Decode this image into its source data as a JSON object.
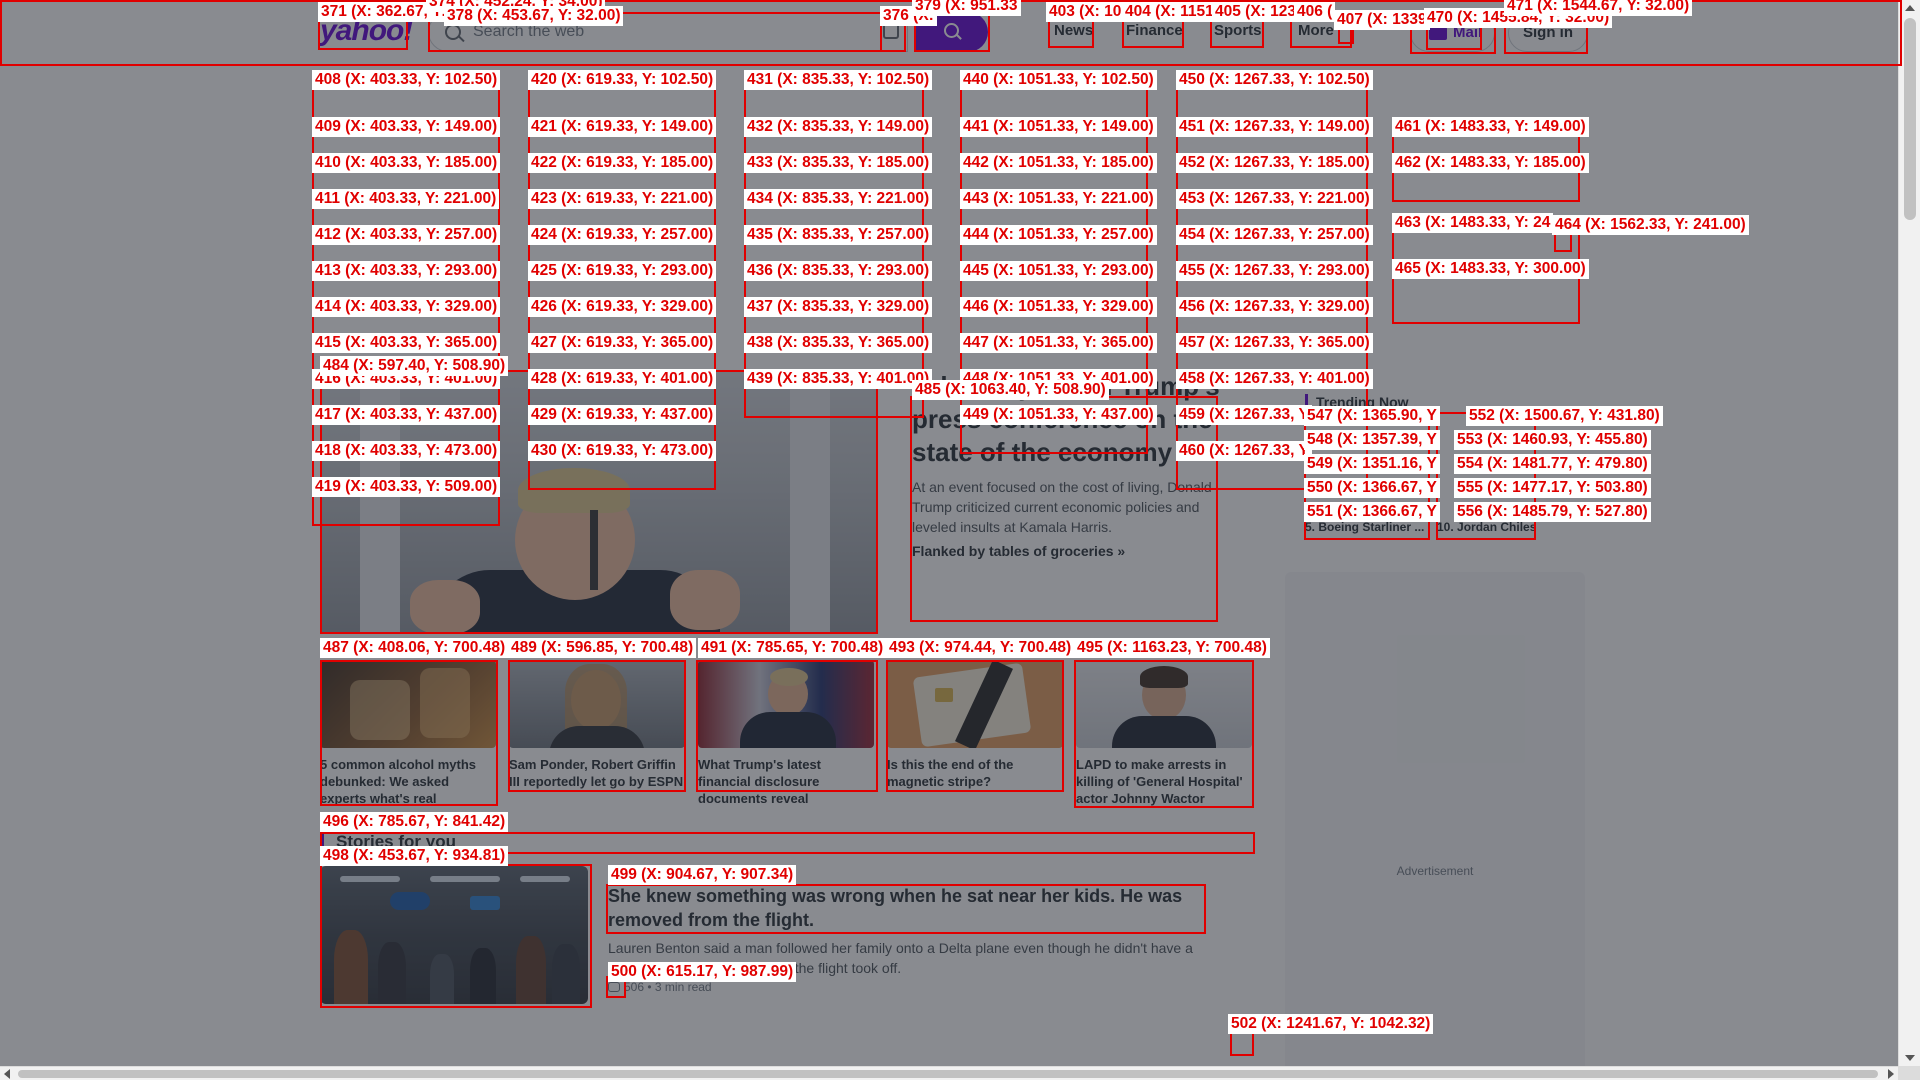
{
  "header": {
    "logo": "yahoo!",
    "search_placeholder": "Search the web",
    "nav": [
      "News",
      "Finance",
      "Sports",
      "More"
    ],
    "mail_label": "Mail",
    "signin_label": "Sign in"
  },
  "hero": {
    "title": "Takeaways from Trump's press conference on the state of the economy",
    "description": "At an event focused on the cost of living, Donald Trump criticized current economic policies and leveled insults at Kamala Harris.",
    "link": "Flanked by tables of groceries »"
  },
  "cards": [
    {
      "title": "5 common alcohol myths debunked: We asked experts what's real",
      "image": "whiskey-glass"
    },
    {
      "title": "Sam Ponder, Robert Griffin III reportedly let go by ESPN",
      "image": "woman-portrait"
    },
    {
      "title": "What Trump's latest financial disclosure documents reveal",
      "image": "trump-flags"
    },
    {
      "title": "Is this the end of the magnetic stripe?",
      "image": "credit-card"
    },
    {
      "title": "LAPD to make arrests in killing of 'General Hospital' actor Johnny Wactor",
      "image": "man-portrait"
    }
  ],
  "stories": {
    "heading": "Stories for you",
    "items": [
      {
        "title": "She knew something was wrong when he sat near her kids. He was removed from the flight.",
        "description": "Lauren Benton said a man followed her family onto a Delta plane even though he didn't have a seat. He was removed before the flight took off.",
        "comments": "506",
        "read_time": "3 min read"
      }
    ]
  },
  "trending": {
    "heading": "Trending Now",
    "left_item": "5. Boeing Starliner ...",
    "right_item": "10. Jordan Chiles"
  },
  "ad_label": "Advertisement",
  "annotations": [
    {
      "text": "371 (X: 362.67, Y: 32.00)"
    },
    {
      "text": "374 (X: 452.24, Y: 34.00)"
    },
    {
      "text": "378 (X: 453.67, Y: 32.00)"
    },
    {
      "text": "376 (X:"
    },
    {
      "text": "379 (X: 951.33"
    },
    {
      "text": "403 (X: 10"
    },
    {
      "text": "404 (X: 1151"
    },
    {
      "text": "405 (X: 123"
    },
    {
      "text": "406 ("
    },
    {
      "text": "407 (X: 1339"
    },
    {
      "text": "470 (X: 1455.84, Y: 32.00)"
    },
    {
      "text": "471 (X: 1544.67, Y: 32.00)"
    },
    {
      "text": "408 (X: 403.33, Y: 102.50)"
    },
    {
      "text": "409 (X: 403.33, Y: 149.00)"
    },
    {
      "text": "410 (X: 403.33, Y: 185.00)"
    },
    {
      "text": "411 (X: 403.33, Y: 221.00)"
    },
    {
      "text": "412 (X: 403.33, Y: 257.00)"
    },
    {
      "text": "413 (X: 403.33, Y: 293.00)"
    },
    {
      "text": "414 (X: 403.33, Y: 329.00)"
    },
    {
      "text": "415 (X: 403.33, Y: 365.00)"
    },
    {
      "text": "416 (X: 403.33, Y: 401.00)"
    },
    {
      "text": "417 (X: 403.33, Y: 437.00)"
    },
    {
      "text": "418 (X: 403.33, Y: 473.00)"
    },
    {
      "text": "419 (X: 403.33, Y: 509.00)"
    },
    {
      "text": "420 (X: 619.33, Y: 102.50)"
    },
    {
      "text": "421 (X: 619.33, Y: 149.00)"
    },
    {
      "text": "422 (X: 619.33, Y: 185.00)"
    },
    {
      "text": "423 (X: 619.33, Y: 221.00)"
    },
    {
      "text": "424 (X: 619.33, Y: 257.00)"
    },
    {
      "text": "425 (X: 619.33, Y: 293.00)"
    },
    {
      "text": "426 (X: 619.33, Y: 329.00)"
    },
    {
      "text": "427 (X: 619.33, Y: 365.00)"
    },
    {
      "text": "428 (X: 619.33, Y: 401.00)"
    },
    {
      "text": "429 (X: 619.33, Y: 437.00)"
    },
    {
      "text": "430 (X: 619.33, Y: 473.00)"
    },
    {
      "text": "431 (X: 835.33, Y: 102.50)"
    },
    {
      "text": "432 (X: 835.33, Y: 149.00)"
    },
    {
      "text": "433 (X: 835.33, Y: 185.00)"
    },
    {
      "text": "434 (X: 835.33, Y: 221.00)"
    },
    {
      "text": "435 (X: 835.33, Y: 257.00)"
    },
    {
      "text": "436 (X: 835.33, Y: 293.00)"
    },
    {
      "text": "437 (X: 835.33, Y: 329.00)"
    },
    {
      "text": "438 (X: 835.33, Y: 365.00)"
    },
    {
      "text": "439 (X: 835.33, Y: 401.00)"
    },
    {
      "text": "440 (X: 1051.33, Y: 102.50)"
    },
    {
      "text": "441 (X: 1051.33, Y: 149.00)"
    },
    {
      "text": "442 (X: 1051.33, Y: 185.00)"
    },
    {
      "text": "443 (X: 1051.33, Y: 221.00)"
    },
    {
      "text": "444 (X: 1051.33, Y: 257.00)"
    },
    {
      "text": "445 (X: 1051.33, Y: 293.00)"
    },
    {
      "text": "446 (X: 1051.33, Y: 329.00)"
    },
    {
      "text": "447 (X: 1051.33, Y: 365.00)"
    },
    {
      "text": "448 (X: 1051.33, Y: 401.00)"
    },
    {
      "text": "449 (X: 1051.33, Y: 437.00)"
    },
    {
      "text": "450 (X: 1267.33, Y: 102.50)"
    },
    {
      "text": "451 (X: 1267.33, Y: 149.00)"
    },
    {
      "text": "452 (X: 1267.33, Y: 185.00)"
    },
    {
      "text": "453 (X: 1267.33, Y: 221.00)"
    },
    {
      "text": "454 (X: 1267.33, Y: 257.00)"
    },
    {
      "text": "455 (X: 1267.33, Y: 293.00)"
    },
    {
      "text": "456 (X: 1267.33, Y: 329.00)"
    },
    {
      "text": "457 (X: 1267.33, Y: 365.00)"
    },
    {
      "text": "458 (X: 1267.33, Y: 401.00)"
    },
    {
      "text": "459 (X: 1267.33, Y"
    },
    {
      "text": "460 (X: 1267.33, Y"
    },
    {
      "text": "461 (X: 1483.33, Y: 149.00)"
    },
    {
      "text": "462 (X: 1483.33, Y: 185.00)"
    },
    {
      "text": "463 (X: 1483.33, Y: 24"
    },
    {
      "text": "464 (X: 1562.33, Y: 241.00)"
    },
    {
      "text": "465 (X: 1483.33, Y: 300.00)"
    },
    {
      "text": "484 (X: 597.40, Y: 508.90)"
    },
    {
      "text": "485 (X: 1063.40, Y: 508.90)"
    },
    {
      "text": "547 (X: 1365.90, Y"
    },
    {
      "text": "552 (X: 1500.67, Y: 431.80)"
    },
    {
      "text": "548 (X: 1357.39, Y"
    },
    {
      "text": "553 (X: 1460.93, Y: 455.80)"
    },
    {
      "text": "549 (X: 1351.16, Y"
    },
    {
      "text": "554 (X: 1481.77, Y: 479.80)"
    },
    {
      "text": "550 (X: 1366.67, Y"
    },
    {
      "text": "555 (X: 1477.17, Y: 503.80)"
    },
    {
      "text": "551 (X: 1366.67, Y"
    },
    {
      "text": "556 (X: 1485.79, Y: 527.80)"
    },
    {
      "text": "487 (X: 408.06, Y: 700.48)"
    },
    {
      "text": "489 (X: 596.85, Y: 700.48)"
    },
    {
      "text": "491 (X: 785.65, Y: 700.48)"
    },
    {
      "text": "493 (X: 974.44, Y: 700.48)"
    },
    {
      "text": "495 (X: 1163.23, Y: 700.48)"
    },
    {
      "text": "496 (X: 785.67, Y: 841.42)"
    },
    {
      "text": "498 (X: 453.67, Y: 934.81)"
    },
    {
      "text": "499 (X: 904.67, Y: 907.34)"
    },
    {
      "text": "500 (X: 615.17, Y: 987.99)"
    },
    {
      "text": "502 (X: 1241.67, Y: 1042.32)"
    }
  ]
}
